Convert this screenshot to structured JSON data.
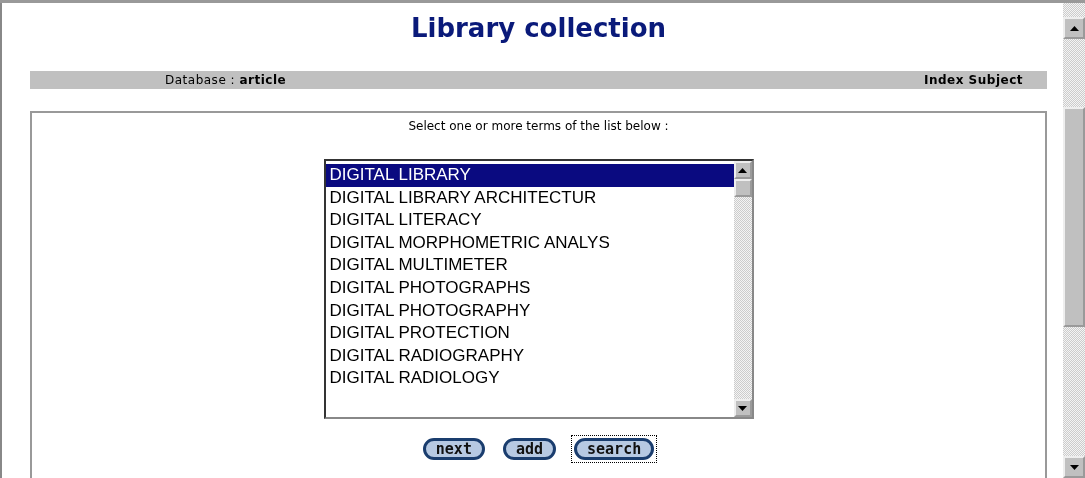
{
  "title": "Library collection",
  "info_bar": {
    "database_label": "Database : ",
    "database_value": "article",
    "index": "Index Subject"
  },
  "instruction": "Select one or more terms of the list below :",
  "terms": [
    {
      "label": "DIGITAL LIBRARY",
      "selected": true
    },
    {
      "label": "DIGITAL LIBRARY ARCHITECTUR",
      "selected": false
    },
    {
      "label": "DIGITAL LITERACY",
      "selected": false
    },
    {
      "label": "DIGITAL MORPHOMETRIC ANALYS",
      "selected": false
    },
    {
      "label": "DIGITAL MULTIMETER",
      "selected": false
    },
    {
      "label": "DIGITAL PHOTOGRAPHS",
      "selected": false
    },
    {
      "label": "DIGITAL PHOTOGRAPHY",
      "selected": false
    },
    {
      "label": "DIGITAL PROTECTION",
      "selected": false
    },
    {
      "label": "DIGITAL RADIOGRAPHY",
      "selected": false
    },
    {
      "label": "DIGITAL RADIOLOGY",
      "selected": false
    }
  ],
  "buttons": [
    {
      "label": "next",
      "focused": false
    },
    {
      "label": "add",
      "focused": false
    },
    {
      "label": "search",
      "focused": true
    }
  ]
}
